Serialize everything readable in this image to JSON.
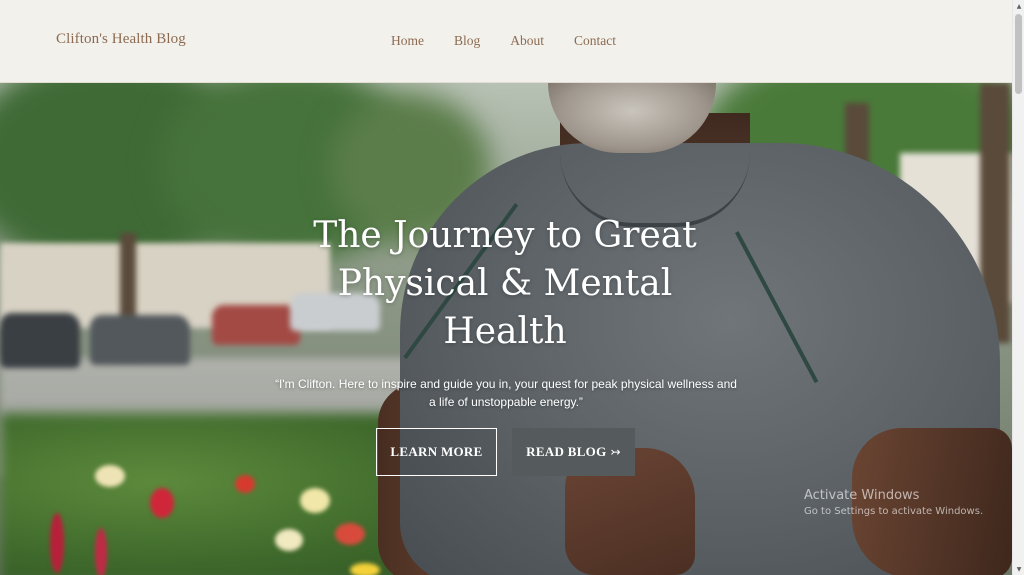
{
  "header": {
    "brand": "Clifton's Health Blog",
    "nav": [
      {
        "label": "Home"
      },
      {
        "label": "Blog"
      },
      {
        "label": "About"
      },
      {
        "label": "Contact"
      }
    ]
  },
  "hero": {
    "title_lines": [
      "The Journey to Great",
      "Physical & Mental",
      "Health"
    ],
    "subtitle_lines": [
      "“I'm Clifton. Here to inspire and guide you in, your quest for peak physical wellness and",
      "a life of unstoppable energy.”"
    ],
    "learn_more_label": "LEARN MORE",
    "read_blog_label": "READ BLOG",
    "read_blog_arrow": "↣"
  },
  "watermark": {
    "title": "Activate Windows",
    "subtitle": "Go to Settings to activate Windows."
  },
  "colors": {
    "header_bg": "#f3f1ec",
    "brand_text": "#8c6b52",
    "read_blog_bg": "#555a5d"
  }
}
